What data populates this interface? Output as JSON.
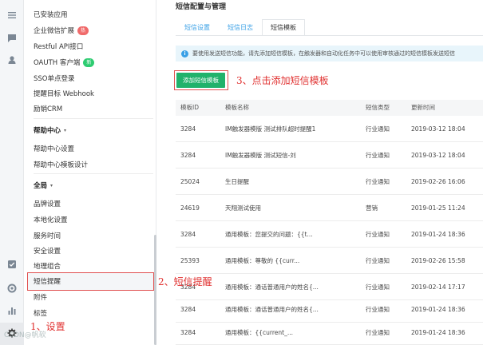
{
  "rail": {
    "icons": [
      "list-icon",
      "chat-icon",
      "user-icon",
      "checklist-icon",
      "lifebuoy-icon",
      "bar-chart-icon",
      "gear-icon"
    ]
  },
  "nav": {
    "items_top": [
      {
        "label": "已安装应用"
      },
      {
        "label": "企业微信扩展",
        "badge": "热",
        "badge_color": "#f06a6a"
      },
      {
        "label": "Restful API接口"
      },
      {
        "label": "OAUTH 客户端",
        "badge": "新",
        "badge_color": "#2ecc71"
      },
      {
        "label": "SSO单点登录"
      },
      {
        "label": "提醒目标 Webhook"
      },
      {
        "label": "励销CRM"
      }
    ],
    "help_header": "帮助中心",
    "help_items": [
      "帮助中心设置",
      "帮助中心模板设计"
    ],
    "global_header": "全局",
    "global_items": [
      "品牌设置",
      "本地化设置",
      "服务时间",
      "安全设置",
      "地理组合",
      "短信提醒",
      "附件",
      "标签"
    ],
    "selected": "短信提醒"
  },
  "main": {
    "page_title": "短信配置与管理",
    "tabs": [
      {
        "label": "短信设置",
        "active": false
      },
      {
        "label": "短信日志",
        "active": false
      },
      {
        "label": "短信模板",
        "active": true
      }
    ],
    "info_text": "要使用发送短信功能，请先添加短信模板，在触发器和自动化任务中可以使用审核通过的短信模板发送短信",
    "add_button": "添加短信模板",
    "table": {
      "headers": [
        "模板ID",
        "模板名称",
        "短信类型",
        "更新时间"
      ],
      "rows": [
        [
          "3284",
          "IM触发器模版 测试排队超时提醒1",
          "行业通知",
          "2019-03-12 18:04"
        ],
        [
          "3284",
          "IM触发器模版 测试短信-刘",
          "行业通知",
          "2019-03-12 18:04"
        ],
        [
          "25024",
          "生日提醒",
          "行业通知",
          "2019-02-26 16:06"
        ],
        [
          "24619",
          "天翔测试使用",
          "营销",
          "2019-01-25 11:24"
        ],
        [
          "3284",
          "通用模板：您提交的问题：{{t...",
          "行业通知",
          "2019-01-24 18:36"
        ],
        [
          "25393",
          "通用模板：尊敬的 {{curr...",
          "行业通知",
          "2019-02-26 15:58"
        ],
        [
          "3284",
          "通用模板：通话普通用户的姓名{...",
          "行业通知",
          "2019-02-14 17:17"
        ],
        [
          "3284",
          "通用模板：通话普通用户的姓名{...",
          "行业通知",
          "2019-01-24 18:36"
        ],
        [
          "3284",
          "通用模板：{{current_...",
          "行业通知",
          "2019-01-24 18:36"
        ]
      ]
    }
  },
  "annotations": {
    "step1": "1、设置",
    "step2": "2、短信提醒",
    "step3": "3、点击添加短信模板"
  },
  "watermark": "CSDN@帆软"
}
